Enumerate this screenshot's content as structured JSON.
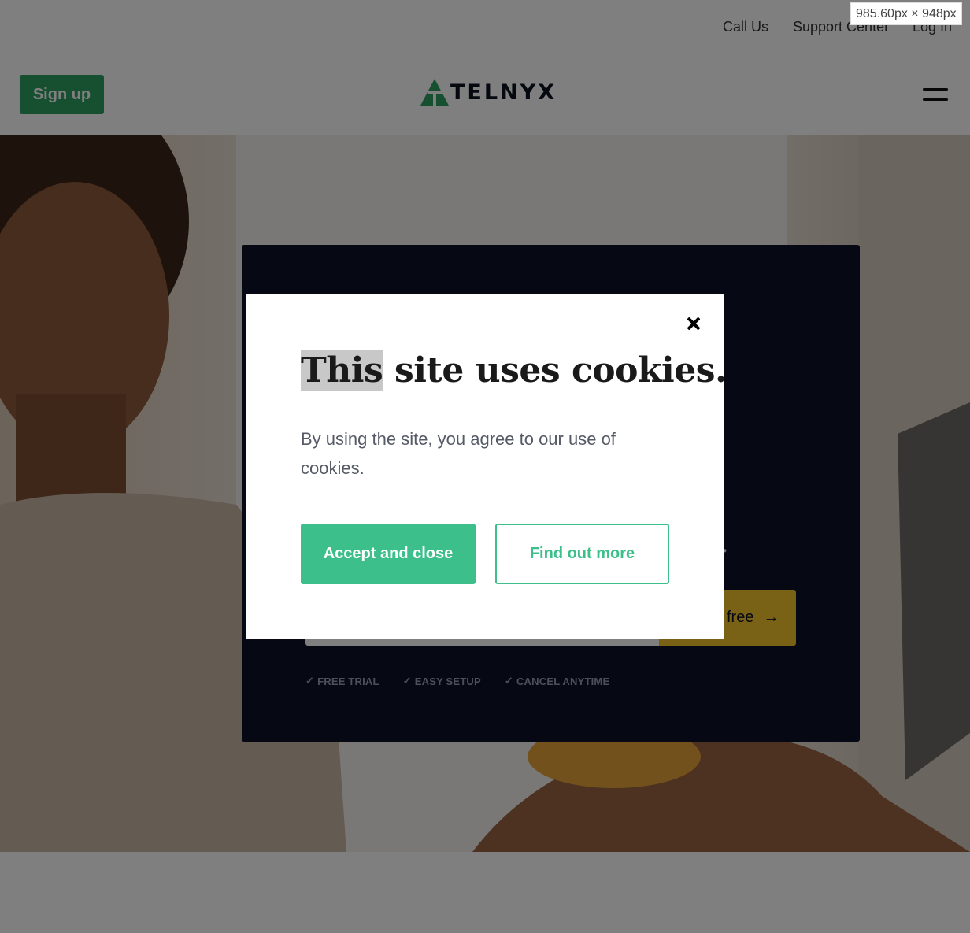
{
  "top_links": [
    "Call Us",
    "Support Center",
    "Log In"
  ],
  "header": {
    "signup_label": "Sign up",
    "logo_text": "TELNYX",
    "brand_color": "#2f9e63"
  },
  "hero": {
    "tagline_tail": "y.",
    "cta_label": "free",
    "benefits": [
      "FREE TRIAL",
      "EASY SETUP",
      "CANCEL ANYTIME"
    ],
    "card_color": "#0d1226",
    "cta_color": "#f2c22a"
  },
  "cookie_modal": {
    "title_highlight": "This",
    "title_rest": " site uses cookies.",
    "body": "By using the site, you agree to our use of cookies.",
    "accept_label": "Accept and close",
    "find_out_label": "Find out more",
    "accent_color": "#3cbf8a"
  },
  "viewport_badge": "985.60px × 948px"
}
